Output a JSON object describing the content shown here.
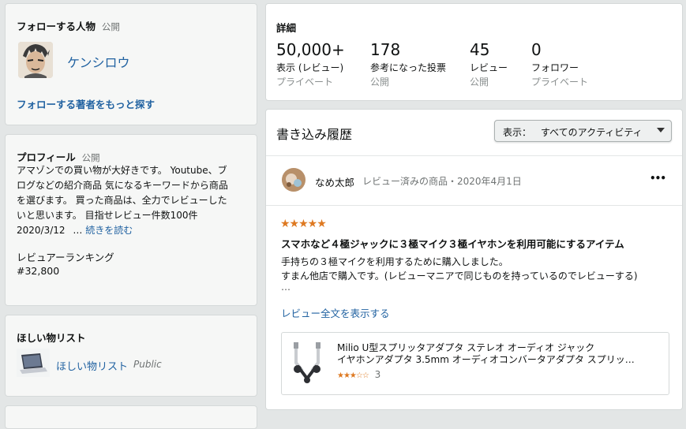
{
  "follow": {
    "title": "フォローする人物",
    "visibility": "公開",
    "person_name": "ケンシロウ",
    "more_link": "フォローする著者をもっと探す"
  },
  "profile": {
    "title": "プロフィール",
    "visibility": "公開",
    "bio_lines": [
      "アマゾンでの買い物が大好きです。 Youtube、ブ",
      "ログなどの紹介商品 気になるキーワードから商品",
      "を選びます。 買った商品は、全力でレビューした",
      "いと思います。 目指せレビュー件数100件"
    ],
    "date": "2020/3/12",
    "ellipsis": "…",
    "read_more": "続きを読む",
    "rank_label": "レビュアーランキング",
    "rank_value": "#32,800"
  },
  "wishlist": {
    "title": "ほしい物リスト",
    "item_label": "ほしい物リスト",
    "item_visibility": "Public"
  },
  "details": {
    "title": "詳細",
    "stats": [
      {
        "value": "50,000+",
        "label": "表示 (レビュー)",
        "sub": "プライベート"
      },
      {
        "value": "178",
        "label": "参考になった投票",
        "sub": "公開"
      },
      {
        "value": "45",
        "label": "レビュー",
        "sub": "公開"
      },
      {
        "value": "0",
        "label": "フォロワー",
        "sub": "プライベート"
      }
    ]
  },
  "history": {
    "title": "書き込み履歴",
    "filter_label": "表示：",
    "filter_value": "すべてのアクティビティ"
  },
  "post": {
    "author": "なめ太郎",
    "meta": "レビュー済みの商品・2020年4月1日",
    "more_icon_text": "•••",
    "rating": 5,
    "headline": "スマホなど４極ジャックに３極マイク３極イヤホンを利用可能にするアイテム",
    "body_lines": [
      "手持ちの３極マイクを利用するために購入しました。",
      "すまん他店で購入です。(レビューマニアで同じものを持っているのでレビューする)",
      "…"
    ],
    "full_review_link": "レビュー全文を表示する",
    "product": {
      "title_line1": "Milio U型スプリッタアダプタ ステレオ オーディオ ジャック",
      "title_line2": "イヤホンアダプタ 3.5mm オーディオコンバータアダプタ スプリッ…",
      "rating": 3.5,
      "review_count": "3"
    }
  },
  "colors": {
    "link": "#2162a1",
    "star": "#de7921",
    "background": "#e3e6e6"
  }
}
